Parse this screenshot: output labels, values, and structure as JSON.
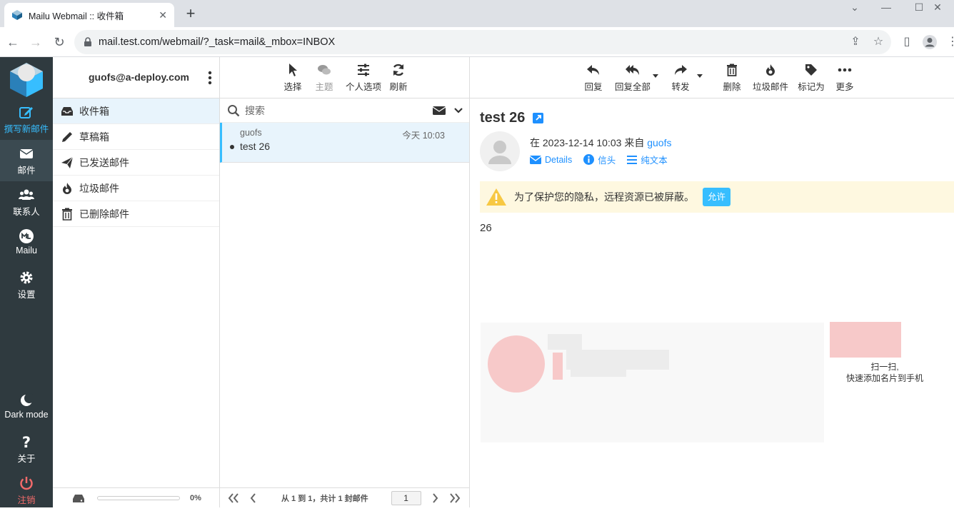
{
  "browser": {
    "tab_title": "Mailu Webmail :: 收件箱",
    "url": "mail.test.com/webmail/?_task=mail&_mbox=INBOX"
  },
  "nav": {
    "compose": "撰写新邮件",
    "mail": "邮件",
    "contacts": "联系人",
    "mailu": "Mailu",
    "settings": "设置",
    "dark_mode": "Dark mode",
    "about": "关于",
    "logout": "注销"
  },
  "folders": {
    "account": "guofs@a-deploy.com",
    "items": [
      {
        "label": "收件箱",
        "icon": "inbox-icon"
      },
      {
        "label": "草稿箱",
        "icon": "pencil-icon"
      },
      {
        "label": "已发送邮件",
        "icon": "paper-plane-icon"
      },
      {
        "label": "垃圾邮件",
        "icon": "fire-icon"
      },
      {
        "label": "已删除邮件",
        "icon": "trash-icon"
      }
    ],
    "quota_pct": "0%"
  },
  "list_toolbar": {
    "select": "选择",
    "threads": "主题",
    "options": "个人选项",
    "refresh": "刷新"
  },
  "search": {
    "placeholder": "搜索"
  },
  "messages": [
    {
      "from": "guofs",
      "date": "今天 10:03",
      "subject": "test 26"
    }
  ],
  "pager": {
    "info": "从 1 到 1，共计 1 封邮件",
    "page": "1"
  },
  "read_toolbar": {
    "reply": "回复",
    "reply_all": "回复全部",
    "forward": "转发",
    "delete": "删除",
    "spam": "垃圾邮件",
    "mark": "标记为",
    "more": "更多"
  },
  "message": {
    "subject": "test 26",
    "header_prefix": "在 2023-12-14 10:03 来自",
    "sender": "guofs",
    "links": {
      "details": "Details",
      "headers": "信头",
      "plain": "纯文本"
    },
    "warning": "为了保护您的隐私，远程资源已被屏蔽。",
    "allow": "允许",
    "body": "26",
    "qr_caption_1": "扫一扫,",
    "qr_caption_2": "快速添加名片到手机"
  },
  "colors": {
    "accent": "#37beff",
    "link": "#1e90ff",
    "nav_bg": "#2f3a3f",
    "logout": "#f06a6a"
  }
}
